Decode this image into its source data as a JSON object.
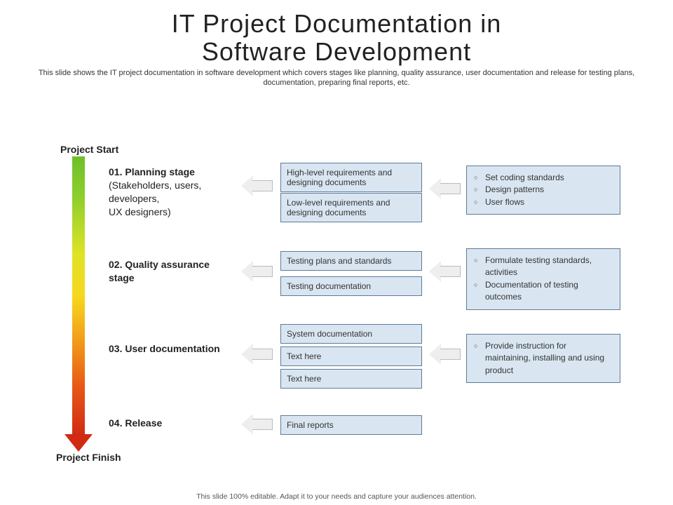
{
  "title_l1": "IT Project Documentation in",
  "title_l2": "Software Development",
  "subtitle": "This slide shows the IT project documentation in software development which covers stages like planning, quality assurance, user documentation and release for testing plans, documentation, preparing final reports, etc.",
  "label_start": "Project Start",
  "label_finish": "Project Finish",
  "stages": {
    "s1": {
      "head": "01. Planning stage",
      "sub": "(Stakeholders, users, developers,\nUX designers)"
    },
    "s2": {
      "head": "02. Quality assurance stage",
      "sub": ""
    },
    "s3": {
      "head": "03. User documentation",
      "sub": ""
    },
    "s4": {
      "head": "04. Release",
      "sub": ""
    }
  },
  "mid": {
    "r1a": "High-level requirements and designing documents",
    "r1b": "Low-level requirements and designing documents",
    "r2a": "Testing plans and standards",
    "r2b": "Testing documentation",
    "r3a": "System documentation",
    "r3b": "Text here",
    "r3c": "Text here",
    "r4a": "Final reports"
  },
  "right": {
    "r1": [
      "Set coding standards",
      "Design patterns",
      "User flows"
    ],
    "r2": [
      "Formulate testing standards, activities",
      "Documentation of testing outcomes"
    ],
    "r3": [
      "Provide instruction for maintaining, installing and using product"
    ]
  },
  "footer": "This slide 100% editable. Adapt it to your needs and capture your audiences attention."
}
